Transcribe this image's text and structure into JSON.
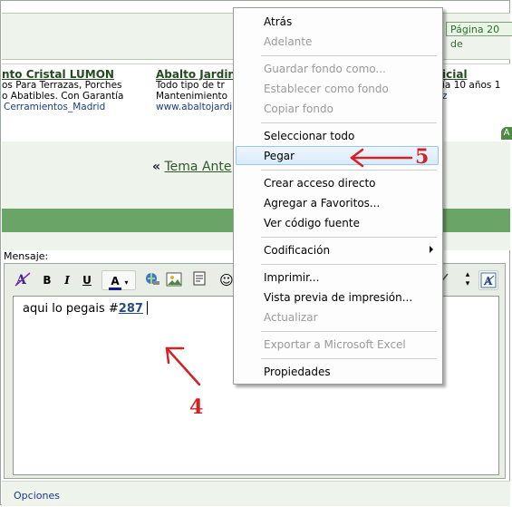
{
  "page_indicator": "Página 20 de",
  "ads": [
    {
      "title": "nto Cristal LUMON",
      "lines": [
        "os Para Terrazas, Porches",
        "o Abatibles. Con Garantía"
      ],
      "url": "Cerramientos_Madrid"
    },
    {
      "title": "Abalto Jardin",
      "lines": [
        "Todo tipo de tr",
        "Mantenimiento"
      ],
      "url": "www.abaltojardi"
    },
    {
      "title": "icial",
      "lines": [
        "ía 10 años 1",
        ""
      ],
      "url": "z"
    }
  ],
  "green_tab": "A",
  "prev_topic": {
    "arrow": "«",
    "label": "Tema Ante"
  },
  "message_label": "Mensaje:",
  "editor_text": {
    "prefix": "aqui lo pegais #",
    "number": "287"
  },
  "options_link": "Opciones",
  "toolbar": {
    "bold": "B",
    "italic": "I",
    "underline": "U",
    "font_color": "A"
  },
  "annotations": {
    "step4": "4",
    "step5": "5"
  },
  "context_menu": {
    "items": [
      {
        "label": "Atrás",
        "enabled": true
      },
      {
        "label": "Adelante",
        "enabled": false
      },
      {
        "label": "Guardar fondo como...",
        "enabled": false
      },
      {
        "label": "Establecer como fondo",
        "enabled": false
      },
      {
        "label": "Copiar fondo",
        "enabled": false
      },
      {
        "label": "Seleccionar todo",
        "enabled": true
      },
      {
        "label": "Pegar",
        "enabled": true,
        "highlighted": true
      },
      {
        "label": "Crear acceso directo",
        "enabled": true
      },
      {
        "label": "Agregar a Favoritos...",
        "enabled": true
      },
      {
        "label": "Ver código fuente",
        "enabled": true
      },
      {
        "label": "Codificación",
        "enabled": true,
        "submenu": true
      },
      {
        "label": "Imprimir...",
        "enabled": true
      },
      {
        "label": "Vista previa de impresión...",
        "enabled": true
      },
      {
        "label": "Actualizar",
        "enabled": false
      },
      {
        "label": "Exportar a Microsoft Excel",
        "enabled": false
      },
      {
        "label": "Propiedades",
        "enabled": true
      }
    ]
  },
  "colors": {
    "forum_green": "#6aa466",
    "annotation_red": "#d22222",
    "menu_highlight": "#d9ebfb"
  }
}
